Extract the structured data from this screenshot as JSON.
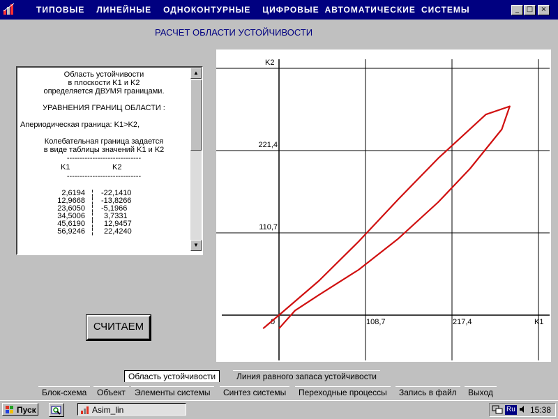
{
  "menu": [
    "ТИПОВЫЕ",
    "ЛИНЕЙНЫЕ",
    "ОДНОКОНТУРНЫЕ",
    "ЦИФРОВЫЕ",
    "АВТОМАТИЧЕСКИЕ",
    "СИСТЕМЫ"
  ],
  "window_buttons": {
    "minimize": "_",
    "maximize": "□",
    "close": "×"
  },
  "heading": "РАСЧЕТ ОБЛАСТИ УСТОЙЧИВОСТИ",
  "info_panel": {
    "lines_top": [
      "Область устойчивости",
      "в плоскости K1 и K2",
      "определяется ДВУМЯ границами."
    ],
    "equations_title": "УРАВНЕНИЯ ГРАНИЦ ОБЛАСТИ :",
    "aperiodic": "Апериодическая граница: K1>K2,",
    "oscillatory": [
      "Колебательная граница задается",
      "в виде таблицы значений K1 и K2"
    ],
    "dashes": "-----------------------------",
    "table_headers": [
      "K1",
      "K2"
    ],
    "rows": [
      [
        "2,6194",
        "-22,1410"
      ],
      [
        "12,9668",
        "-13,8266"
      ],
      [
        "23,6050",
        "-5,1966"
      ],
      [
        "34,5006",
        "3,7331"
      ],
      [
        "45,6190",
        "12,9457"
      ],
      [
        "56,9246",
        "22,4240"
      ]
    ]
  },
  "calc_button": "СЧИТАЕМ",
  "chart_data": {
    "type": "line",
    "xlabel": "K1",
    "ylabel": "K2",
    "x_ticks": [
      "0",
      "108,7",
      "217,4"
    ],
    "y_ticks": [
      "110,7",
      "221,4"
    ],
    "xlim": [
      -20,
      330
    ],
    "ylim": [
      -20,
      330
    ],
    "grid": true,
    "series": [
      {
        "color": "#d01010",
        "points": [
          [
            -20,
            -18
          ],
          [
            0,
            0
          ],
          [
            50,
            46
          ],
          [
            100,
            99
          ],
          [
            150,
            156
          ],
          [
            200,
            211
          ],
          [
            260,
            270
          ],
          [
            290,
            281
          ],
          [
            280,
            250
          ],
          [
            240,
            197
          ],
          [
            200,
            152
          ],
          [
            150,
            103
          ],
          [
            100,
            61
          ],
          [
            50,
            27
          ],
          [
            20,
            6
          ],
          [
            0,
            -18
          ]
        ]
      }
    ]
  },
  "tabs_row1": [
    "Область устойчивости",
    "Линия равного запаса устойчивости"
  ],
  "tabs_row2": [
    "Блок-схема",
    "Объект",
    "Элементы системы",
    "Синтез системы",
    "Переходные процессы",
    "Запись в файл",
    "Выход"
  ],
  "taskbar": {
    "start": "Пуск",
    "task": "Asim_lin",
    "lang": "Ru",
    "clock": "15:38"
  }
}
